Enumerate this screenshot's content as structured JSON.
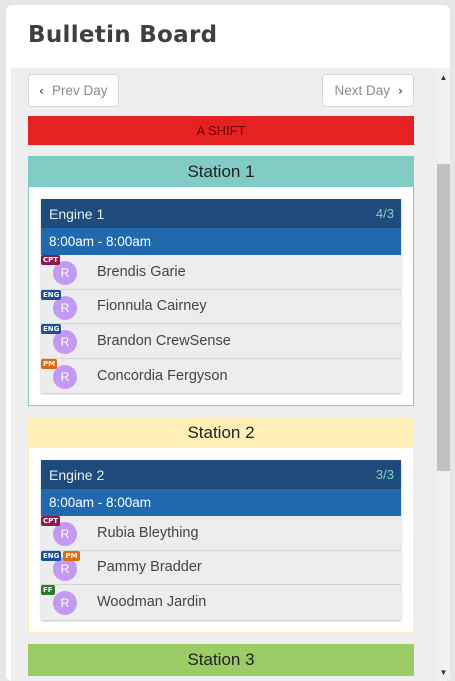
{
  "header": {
    "title": "Bulletin Board"
  },
  "nav": {
    "prev_label": "Prev Day",
    "next_label": "Next Day",
    "prev_icon": "chevron-left-icon",
    "next_icon": "chevron-right-icon"
  },
  "shift": {
    "label": "A SHIFT",
    "color": "#e52121"
  },
  "stations": [
    {
      "name": "Station 1",
      "head_color": "#80cbc4",
      "border_color": "#80cbc4",
      "engine": {
        "name": "Engine 1",
        "count": "4/3",
        "time": "8:00am - 8:00am",
        "crew": [
          {
            "badges": [
              "CPT"
            ],
            "initial": "R",
            "name": "Brendis Garie"
          },
          {
            "badges": [
              "ENG"
            ],
            "initial": "R",
            "name": "Fionnula Cairney"
          },
          {
            "badges": [
              "ENG"
            ],
            "initial": "R",
            "name": "Brandon CrewSense"
          },
          {
            "badges": [
              "PM"
            ],
            "initial": "R",
            "name": "Concordia Fergyson"
          }
        ]
      }
    },
    {
      "name": "Station 2",
      "head_color": "#fdefb6",
      "border_color": "#fdefb6",
      "engine": {
        "name": "Engine 2",
        "count": "3/3",
        "time": "8:00am - 8:00am",
        "crew": [
          {
            "badges": [
              "CPT"
            ],
            "initial": "R",
            "name": "Rubia Bleything"
          },
          {
            "badges": [
              "ENG",
              "PM"
            ],
            "initial": "R",
            "name": "Pammy Bradder"
          },
          {
            "badges": [
              "FF"
            ],
            "initial": "R",
            "name": "Woodman Jardin"
          }
        ]
      }
    },
    {
      "name": "Station 3",
      "head_color": "#9ccc65",
      "border_color": "#9ccc65"
    }
  ],
  "scrollbar": {
    "up_icon": "scroll-up-arrow-icon",
    "down_icon": "scroll-down-arrow-icon"
  }
}
